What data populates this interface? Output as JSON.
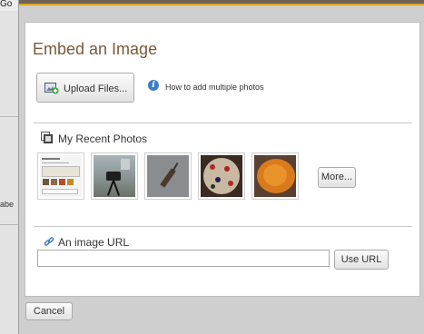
{
  "background": {
    "go_text": "Go",
    "side_text": "abe"
  },
  "dialog": {
    "title": "Embed an Image",
    "upload_button": "Upload Files...",
    "help_link": "How to add multiple photos",
    "recent_photos": {
      "heading": "My Recent Photos",
      "thumbnails": [
        "screenshot-page",
        "telescope-tripod",
        "wood-on-pavement",
        "pizza",
        "casserole"
      ],
      "more_button": "More..."
    },
    "image_url": {
      "heading": "An image URL",
      "input_value": "",
      "input_placeholder": "",
      "use_button": "Use URL"
    },
    "cancel_button": "Cancel"
  },
  "colors": {
    "title": "#7a5a3a",
    "accent_bar": "#e0a32a",
    "info_icon": "#3d7fc1"
  }
}
